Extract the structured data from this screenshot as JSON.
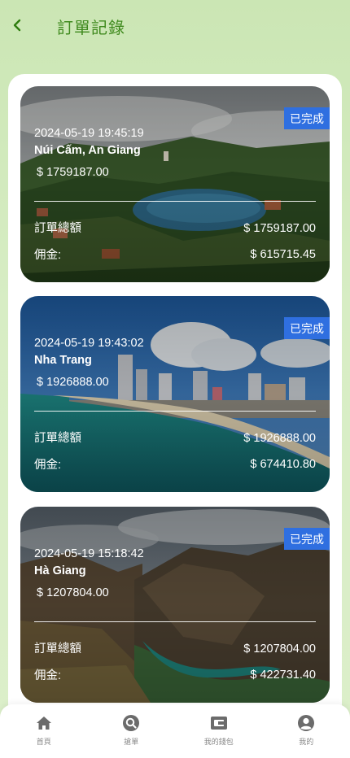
{
  "header": {
    "title": "訂單記錄",
    "back_icon": "chevron-left-icon",
    "accent_color": "#3f8a1e"
  },
  "orders": [
    {
      "status": "已完成",
      "time": "2024-05-19 19:45:19",
      "place": "Núi Cấm, An Giang",
      "amount": "$ 1759187.00",
      "total_label": "訂單總額",
      "total_value": "$ 1759187.00",
      "commission_label": "佣金:",
      "commission_value": "$ 615715.45"
    },
    {
      "status": "已完成",
      "time": "2024-05-19 19:43:02",
      "place": "Nha Trang",
      "amount": "$ 1926888.00",
      "total_label": "訂單總額",
      "total_value": "$ 1926888.00",
      "commission_label": "佣金:",
      "commission_value": "$ 674410.80"
    },
    {
      "status": "已完成",
      "time": "2024-05-19 15:18:42",
      "place": "Hà Giang",
      "amount": "$ 1207804.00",
      "total_label": "訂單總額",
      "total_value": "$ 1207804.00",
      "commission_label": "佣金:",
      "commission_value": "$ 422731.40"
    }
  ],
  "tabbar": {
    "items": [
      {
        "label": "首頁",
        "icon": "home-icon"
      },
      {
        "label": "搶單",
        "icon": "search-grab-icon"
      },
      {
        "label": "我的錢包",
        "icon": "wallet-icon"
      },
      {
        "label": "我的",
        "icon": "user-icon"
      }
    ]
  },
  "colors": {
    "status_badge": "#2f6fe0",
    "background": "#cbe6b4"
  }
}
